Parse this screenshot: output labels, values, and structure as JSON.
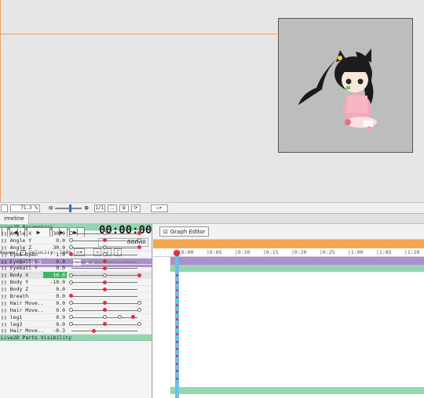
{
  "zoom": {
    "percent": "71.3 %",
    "range_label": "1/1"
  },
  "tab": {
    "label": "imeline"
  },
  "transport": {
    "timecode": "00:00:00",
    "frames": "00000"
  },
  "controls": {
    "repeat": "Repeat",
    "velocity": "Velocity: 100%"
  },
  "model": {
    "name": "for pixel2"
  },
  "groups": {
    "params": "Live2D Parameters",
    "parts": "Live2D Parts Visibility"
  },
  "graph_editor": {
    "label": "Graph Editor"
  },
  "ticks": [
    "0:00",
    "0:05",
    "0:10",
    "0:15",
    "0:20",
    "0:25",
    "1:00",
    "1:05",
    "1:10"
  ],
  "params": [
    {
      "name": "Angle X",
      "value": "30.0"
    },
    {
      "name": "Angle Y",
      "value": "0.0"
    },
    {
      "name": "Angle Z",
      "value": "30.0"
    },
    {
      "name": "EyeL Open",
      "value": "1.0"
    },
    {
      "name": "Eyeball X",
      "value": "0.0"
    },
    {
      "name": "Eyeball Y",
      "value": "0.0"
    },
    {
      "name": "Body X",
      "value": "10.0"
    },
    {
      "name": "Body Y",
      "value": "-10.0"
    },
    {
      "name": "Body Z",
      "value": "0.0"
    },
    {
      "name": "Breath",
      "value": "0.0"
    },
    {
      "name": "Hair Move...",
      "value": "0.0"
    },
    {
      "name": "Hair Move...",
      "value": "0.0"
    },
    {
      "name": "leg1",
      "value": "0.9"
    },
    {
      "name": "leg2",
      "value": "0.0"
    },
    {
      "name": "Hair Move...",
      "value": "-0.3"
    }
  ],
  "colors": {
    "accent": "#f0a950",
    "model": "#ab90cf",
    "group": "#94d6b0",
    "key": "#e03040"
  }
}
